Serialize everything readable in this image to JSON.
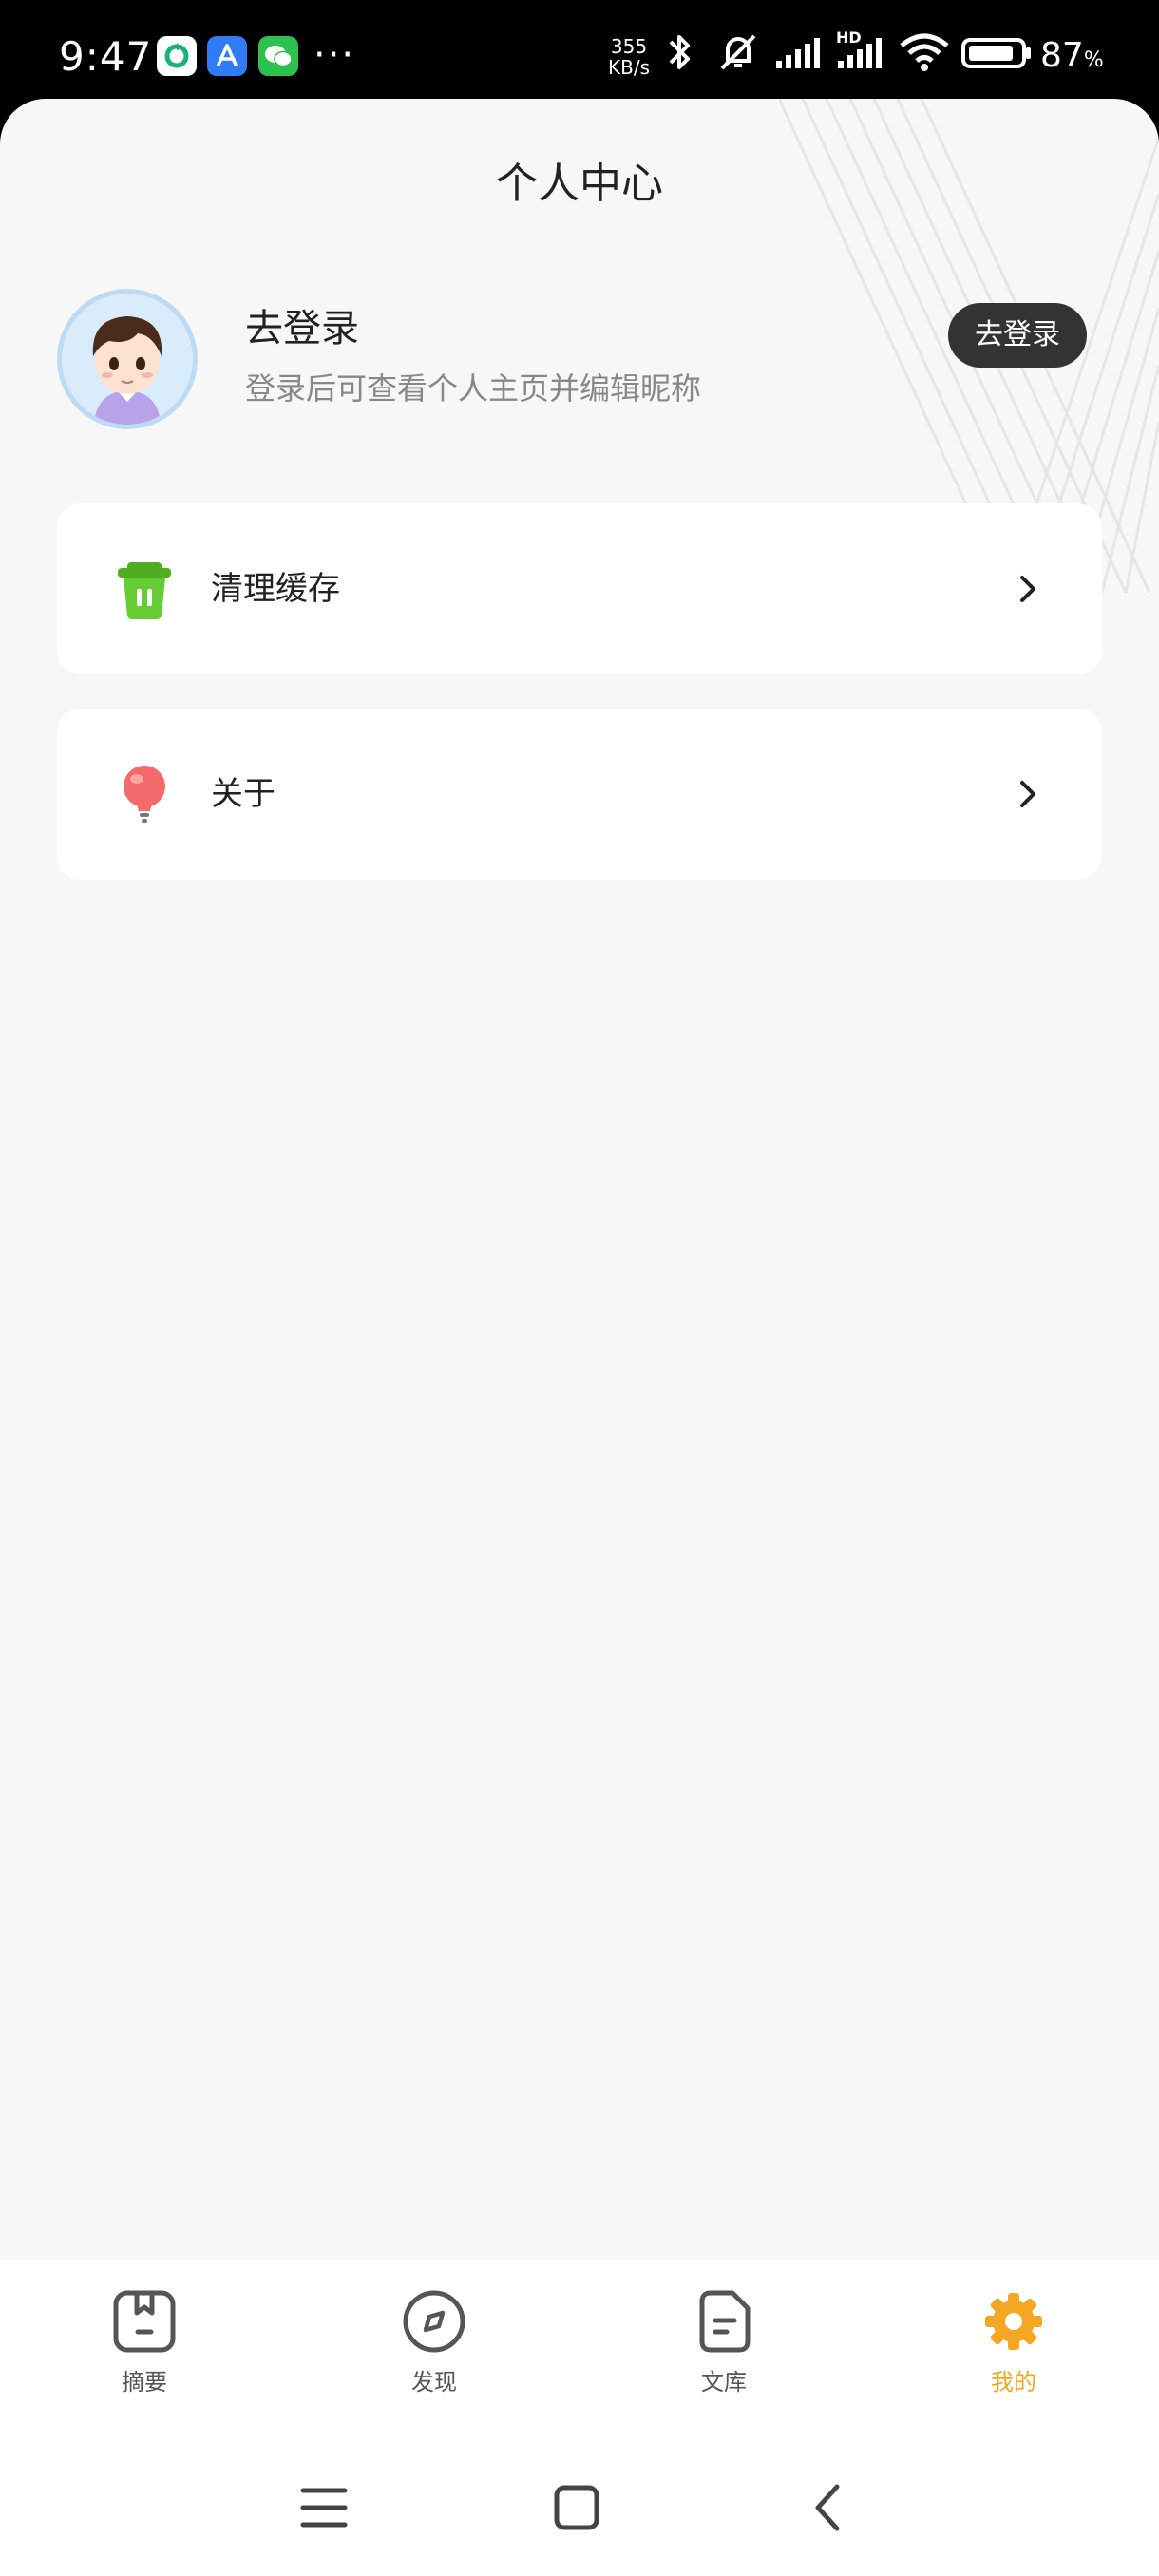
{
  "status_bar": {
    "time": "9:47",
    "net_speed_value": "355",
    "net_speed_unit": "KB/s",
    "network_badge": "HD",
    "battery_level": "87",
    "battery_unit": "%",
    "overflow_dots": "···",
    "app_icons": [
      "sync-app-icon",
      "app-store-icon",
      "wechat-icon"
    ]
  },
  "page": {
    "title": "个人中心"
  },
  "profile": {
    "name": "去登录",
    "subtitle": "登录后可查看个人主页并编辑昵称",
    "login_button": "去登录"
  },
  "menu": [
    {
      "label": "清理缓存",
      "icon": "trash-can-icon",
      "color": "#5ec42c"
    },
    {
      "label": "关于",
      "icon": "light-bulb-icon",
      "color": "#f26a6a"
    }
  ],
  "tabbar": {
    "active_color": "#f5a623",
    "tabs": [
      {
        "label": "摘要",
        "icon": "bookmark-book-icon",
        "active": false
      },
      {
        "label": "发现",
        "icon": "compass-icon",
        "active": false
      },
      {
        "label": "文库",
        "icon": "document-icon",
        "active": false
      },
      {
        "label": "我的",
        "icon": "gear-icon",
        "active": true
      }
    ]
  }
}
